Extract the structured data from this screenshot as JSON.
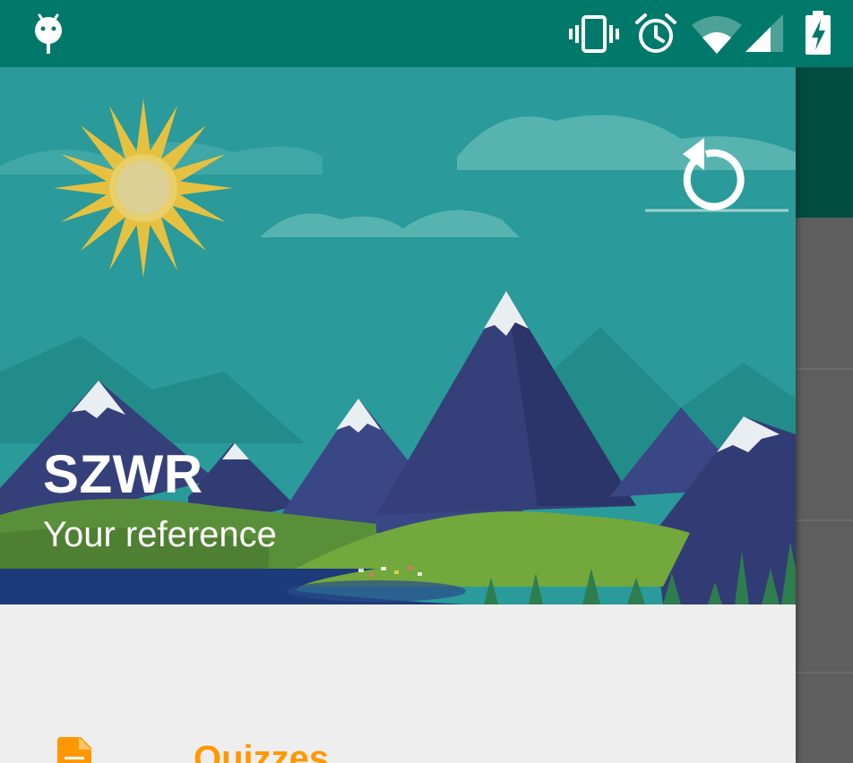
{
  "status_bar": {
    "icons": [
      "android-debug-icon",
      "vibrate-icon",
      "alarm-icon",
      "wifi-icon",
      "cell-signal-icon",
      "battery-charging-icon"
    ],
    "color": "#00796b"
  },
  "drawer": {
    "header": {
      "title": "SZWR",
      "subtitle": "Your reference",
      "action_icon": "refresh-icon"
    },
    "items": [
      {
        "label": "Quizzes",
        "icon": "document-icon",
        "color": "#ff9800"
      }
    ]
  },
  "colors": {
    "primary": "#00796b",
    "primary_dark": "#004d40",
    "accent": "#ff9800",
    "sky": "#2a9a9a"
  }
}
